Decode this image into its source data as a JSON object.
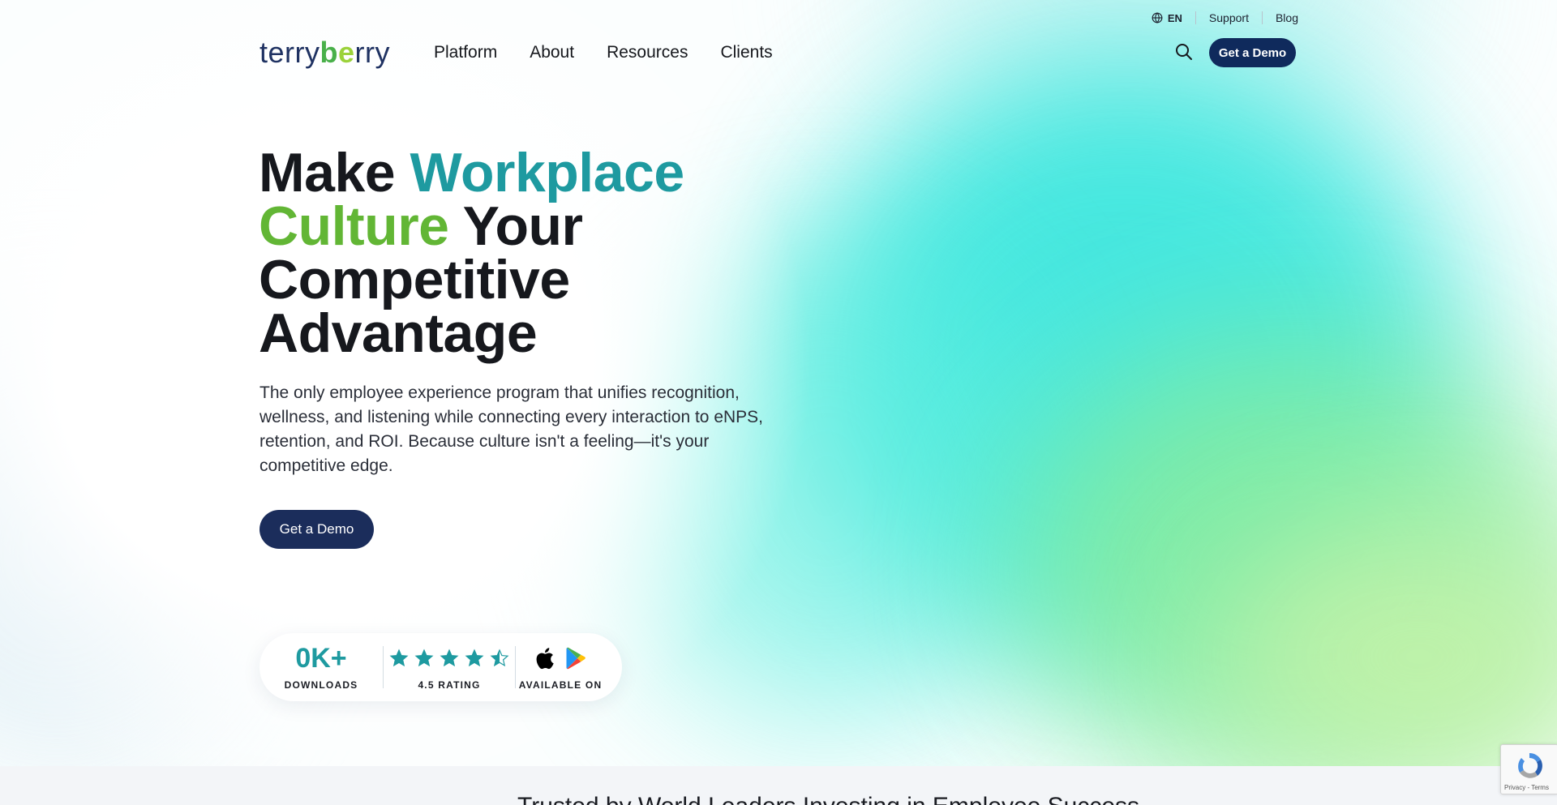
{
  "utility_bar": {
    "language": "EN",
    "support": "Support",
    "blog": "Blog"
  },
  "header": {
    "logo_part1": "terry",
    "logo_part2": "b",
    "logo_part3": "e",
    "logo_part4": "rry",
    "nav": [
      "Platform",
      "About",
      "Resources",
      "Clients"
    ],
    "cta": "Get a Demo"
  },
  "hero": {
    "title_make": "Make ",
    "title_workplace": "Workplace",
    "title_culture": "Culture",
    "title_your": " Your",
    "title_competitive": "Competitive",
    "title_advantage": "Advantage",
    "subtitle": "The only employee experience program that unifies recognition, wellness, and listening while connecting every interaction to eNPS, retention, and ROI. Because culture isn't a feeling—it's your competitive edge.",
    "cta": "Get a Demo"
  },
  "stats": {
    "downloads_value": "0K+",
    "downloads_label": "DOWNLOADS",
    "rating": 4.5,
    "rating_label": "4.5 RATING",
    "available_label": "AVAILABLE ON",
    "apps": [
      "apple-icon",
      "google-play-icon"
    ]
  },
  "next_section": {
    "title": "Trusted by World Leaders Investing in Employee Success"
  },
  "recaptcha": {
    "terms": "Privacy - Terms"
  },
  "colors": {
    "brand_navy": "#0f2a5c",
    "accent_teal": "#1e9aa0",
    "accent_green": "#62b635"
  }
}
